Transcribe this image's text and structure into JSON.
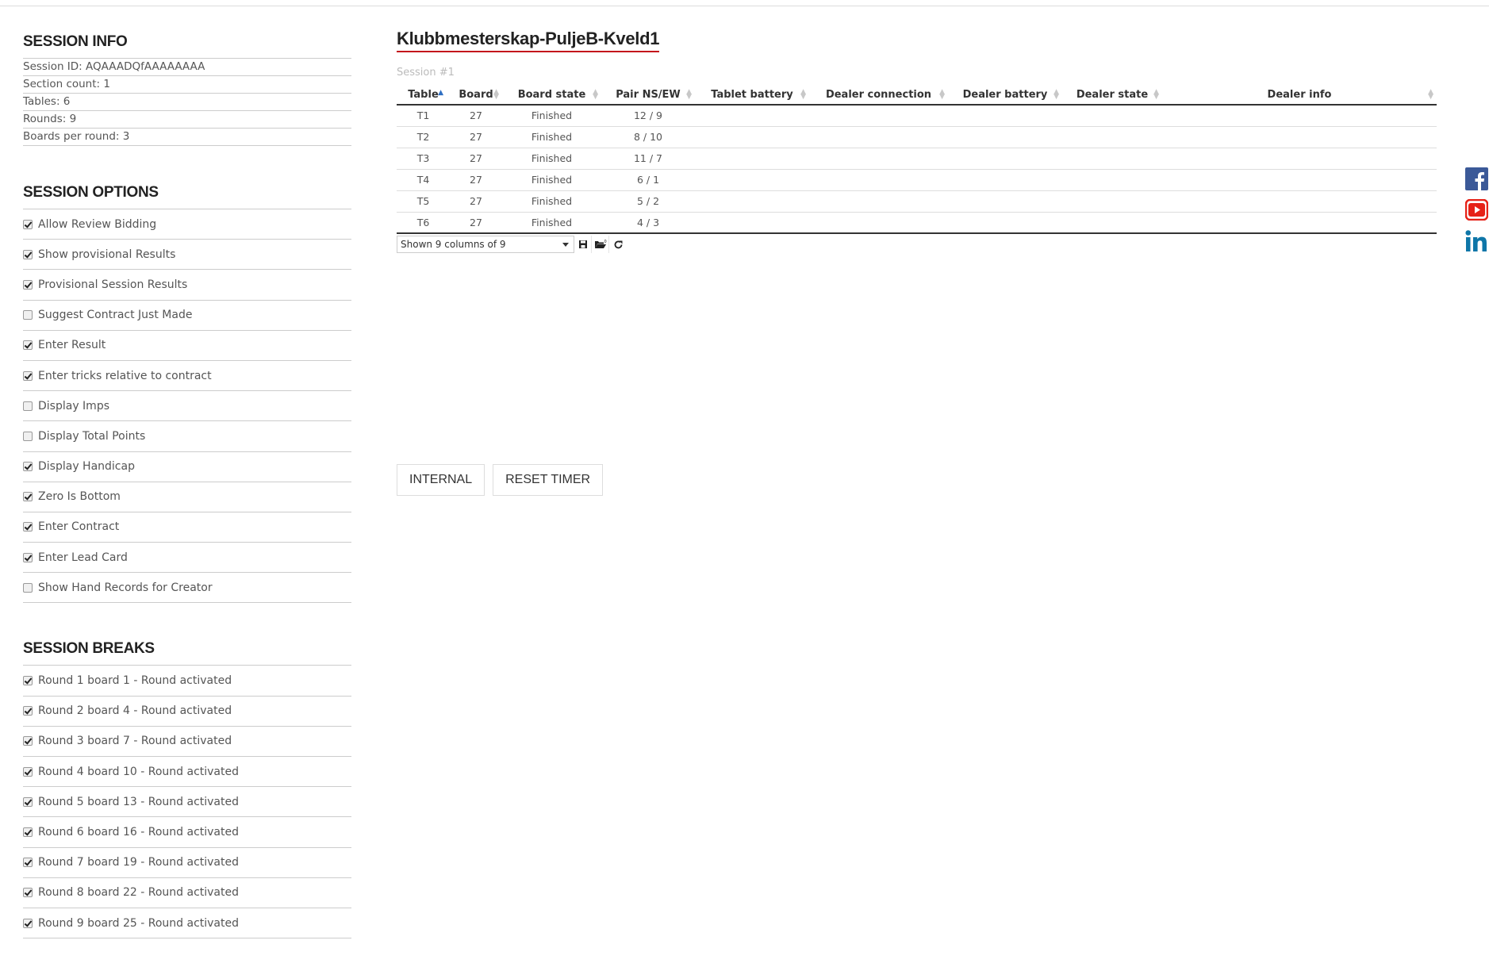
{
  "session_info": {
    "title": "SESSION INFO",
    "rows": [
      "Session ID: AQAAADQfAAAAAAAA",
      "Section count: 1",
      "Tables: 6",
      "Rounds: 9",
      "Boards per round: 3"
    ]
  },
  "session_options": {
    "title": "SESSION OPTIONS",
    "items": [
      {
        "label": "Allow Review Bidding",
        "checked": true
      },
      {
        "label": "Show provisional Results",
        "checked": true
      },
      {
        "label": "Provisional Session Results",
        "checked": true
      },
      {
        "label": "Suggest Contract Just Made",
        "checked": false
      },
      {
        "label": "Enter Result",
        "checked": true
      },
      {
        "label": "Enter tricks relative to contract",
        "checked": true
      },
      {
        "label": "Display Imps",
        "checked": false
      },
      {
        "label": "Display Total Points",
        "checked": false
      },
      {
        "label": "Display Handicap",
        "checked": true
      },
      {
        "label": "Zero Is Bottom",
        "checked": true
      },
      {
        "label": "Enter Contract",
        "checked": true
      },
      {
        "label": "Enter Lead Card",
        "checked": true
      },
      {
        "label": "Show Hand Records for Creator",
        "checked": false
      }
    ]
  },
  "session_breaks": {
    "title": "SESSION BREAKS",
    "items": [
      {
        "label": "Round 1 board 1 - Round activated",
        "checked": true
      },
      {
        "label": "Round 2 board 4 - Round activated",
        "checked": true
      },
      {
        "label": "Round 3 board 7 - Round activated",
        "checked": true
      },
      {
        "label": "Round 4 board 10 - Round activated",
        "checked": true
      },
      {
        "label": "Round 5 board 13 - Round activated",
        "checked": true
      },
      {
        "label": "Round 6 board 16 - Round activated",
        "checked": true
      },
      {
        "label": "Round 7 board 19 - Round activated",
        "checked": true
      },
      {
        "label": "Round 8 board 22 - Round activated",
        "checked": true
      },
      {
        "label": "Round 9 board 25 - Round activated",
        "checked": true
      }
    ]
  },
  "main": {
    "title": "Klubbmesterskap-PuljeB-Kveld1",
    "session_label": "Session #1",
    "columns": [
      "Table",
      "Board",
      "Board state",
      "Pair NS/EW",
      "Tablet battery",
      "Dealer connection",
      "Dealer battery",
      "Dealer state",
      "Dealer info"
    ],
    "rows": [
      [
        "T1",
        "27",
        "Finished",
        "12 / 9",
        "",
        "",
        "",
        "",
        ""
      ],
      [
        "T2",
        "27",
        "Finished",
        "8 / 10",
        "",
        "",
        "",
        "",
        ""
      ],
      [
        "T3",
        "27",
        "Finished",
        "11 / 7",
        "",
        "",
        "",
        "",
        ""
      ],
      [
        "T4",
        "27",
        "Finished",
        "6 / 1",
        "",
        "",
        "",
        "",
        ""
      ],
      [
        "T5",
        "27",
        "Finished",
        "5 / 2",
        "",
        "",
        "",
        "",
        ""
      ],
      [
        "T6",
        "27",
        "Finished",
        "4 / 3",
        "",
        "",
        "",
        "",
        ""
      ]
    ],
    "column_selector": "Shown 9 columns of 9",
    "pager_icons": [
      "save-icon",
      "folder-open-icon",
      "refresh-icon"
    ],
    "buttons": {
      "internal": "INTERNAL",
      "reset_timer": "RESET TIMER"
    }
  },
  "social": [
    "facebook-icon",
    "youtube-icon",
    "linkedin-icon"
  ],
  "colors": {
    "accent_underline": "#c4161c",
    "facebook": "#3b5998",
    "youtube": "#e62117",
    "linkedin": "#0e76a8"
  }
}
